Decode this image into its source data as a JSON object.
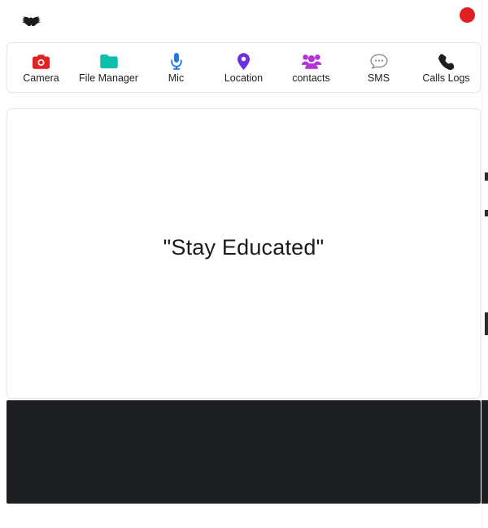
{
  "app": {
    "background_color": "#ffffff",
    "card_border_color": "#e4e6e8"
  },
  "header": {
    "logo_name": "bat-eagle-logo",
    "logo_alt": "Bat wings logo",
    "status_indicator": {
      "name": "recording-indicator",
      "color": "#e02020",
      "shape": "circle"
    }
  },
  "nav": {
    "items": [
      {
        "label": "Camera",
        "icon": "camera-icon",
        "color": "#e02424"
      },
      {
        "label": "File Manager",
        "icon": "folder-icon",
        "color": "#0bbfad"
      },
      {
        "label": "Mic",
        "icon": "microphone-icon",
        "color": "#1f7ae0"
      },
      {
        "label": "Location",
        "icon": "map-pin-icon",
        "color": "#6f2fe0"
      },
      {
        "label": "contacts",
        "icon": "contacts-icon",
        "color": "#b236d6"
      },
      {
        "label": "SMS",
        "icon": "sms-bubble-icon",
        "color": "#8a8a8a"
      },
      {
        "label": "Calls Logs",
        "icon": "phone-icon",
        "color": "#1d1d1d"
      }
    ]
  },
  "main": {
    "headline": "\"Stay Educated\"",
    "headline_color": "#1b1b1b"
  },
  "footer": {
    "background_color": "#1c1e21",
    "content": ""
  },
  "scrollbar": {
    "name": "page-scrollbar",
    "orientation": "vertical"
  }
}
